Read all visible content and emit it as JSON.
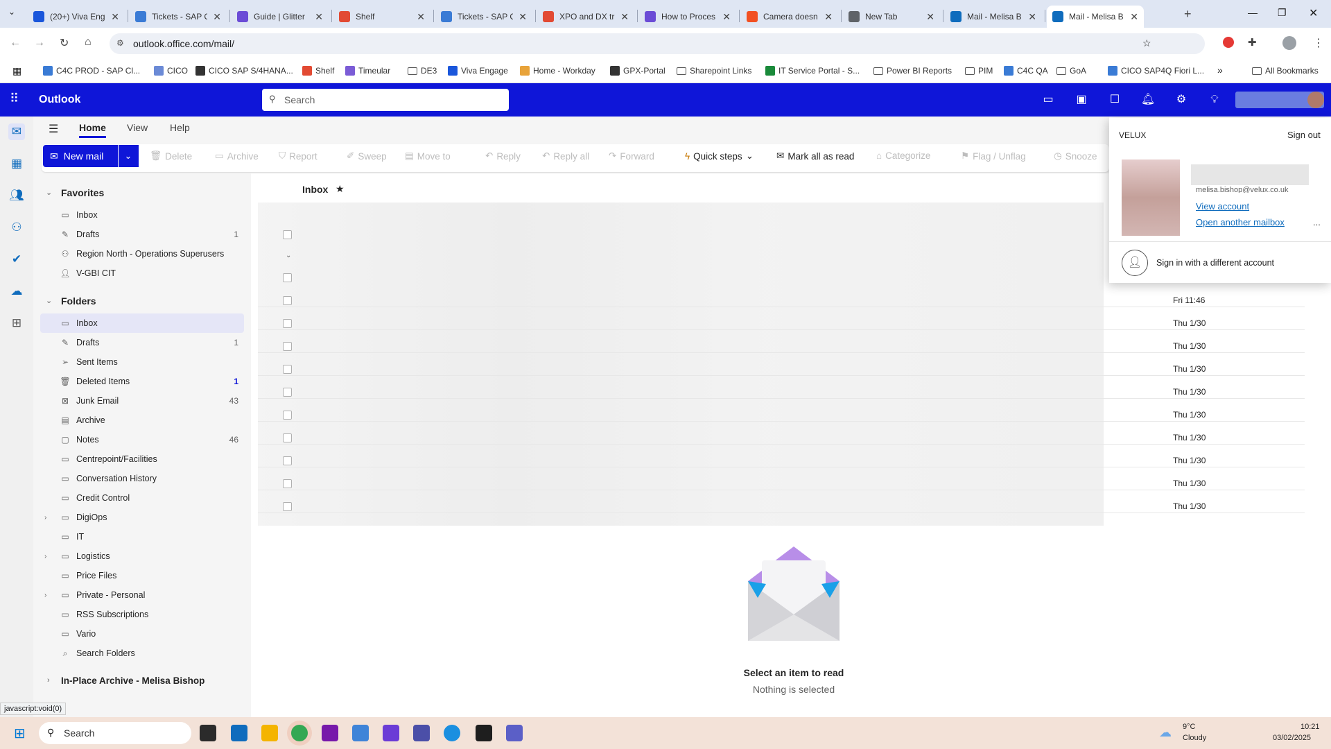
{
  "browser": {
    "tabs": [
      {
        "label": "(20+) Viva Eng",
        "color": "#1a56db"
      },
      {
        "label": "Tickets - SAP C",
        "color": "#3a7bd5"
      },
      {
        "label": "Guide | Glitter",
        "color": "#6b4cd6"
      },
      {
        "label": "Shelf",
        "color": "#e24a33"
      },
      {
        "label": "Tickets - SAP C",
        "color": "#3a7bd5"
      },
      {
        "label": "XPO and DX tr",
        "color": "#e24a33"
      },
      {
        "label": "How to Proces",
        "color": "#6b4cd6"
      },
      {
        "label": "Camera doesn",
        "color": "#f25022"
      },
      {
        "label": "New Tab",
        "color": "#5f6368"
      },
      {
        "label": "Mail - Melisa B",
        "color": "#0f6cbd"
      },
      {
        "label": "Mail - Melisa B",
        "color": "#0f6cbd"
      }
    ],
    "url": "outlook.office.com/mail/",
    "bookmarks": [
      "C4C PROD - SAP Cl...",
      "CICO",
      "CICO SAP S/4HANA...",
      "Shelf",
      "Timeular",
      "DE3",
      "Viva Engage",
      "Home - Workday",
      "GPX-Portal",
      "Sharepoint Links",
      "IT Service Portal - S...",
      "Power BI Reports",
      "PIM",
      "C4C QA",
      "GoA",
      "CICO SAP4Q Fiori L..."
    ],
    "all_bookmarks": "All Bookmarks",
    "status_url": "javascript:void(0)"
  },
  "outlook": {
    "app_name": "Outlook",
    "search_placeholder": "Search",
    "ribbon_tabs": [
      "Home",
      "View",
      "Help"
    ],
    "new_mail": "New mail",
    "actions": {
      "delete": "Delete",
      "archive": "Archive",
      "report": "Report",
      "sweep": "Sweep",
      "move_to": "Move to",
      "reply": "Reply",
      "reply_all": "Reply all",
      "forward": "Forward",
      "quick_steps": "Quick steps",
      "mark_all_read": "Mark all as read",
      "categorize": "Categorize",
      "flag": "Flag / Unflag",
      "snooze": "Snooze"
    },
    "favorites_label": "Favorites",
    "favorites": [
      {
        "label": "Inbox",
        "count": "",
        "icon": "inbox-icon"
      },
      {
        "label": "Drafts",
        "count": "1",
        "icon": "drafts-icon"
      },
      {
        "label": "Region North - Operations Superusers",
        "count": "",
        "icon": "group-icon"
      },
      {
        "label": "V-GBI CIT",
        "count": "",
        "icon": "person-icon"
      }
    ],
    "folders_label": "Folders",
    "folders": [
      {
        "label": "Inbox",
        "count": ""
      },
      {
        "label": "Drafts",
        "count": "1"
      },
      {
        "label": "Sent Items",
        "count": ""
      },
      {
        "label": "Deleted Items",
        "count": "1"
      },
      {
        "label": "Junk Email",
        "count": "43"
      },
      {
        "label": "Archive",
        "count": ""
      },
      {
        "label": "Notes",
        "count": "46"
      },
      {
        "label": "Centrepoint/Facilities",
        "count": ""
      },
      {
        "label": "Conversation History",
        "count": ""
      },
      {
        "label": "Credit Control",
        "count": ""
      },
      {
        "label": "DigiOps",
        "count": ""
      },
      {
        "label": "IT",
        "count": ""
      },
      {
        "label": "Logistics",
        "count": ""
      },
      {
        "label": "Price Files",
        "count": ""
      },
      {
        "label": "Private - Personal",
        "count": ""
      },
      {
        "label": "RSS Subscriptions",
        "count": ""
      },
      {
        "label": "Vario",
        "count": ""
      },
      {
        "label": "Search Folders",
        "count": ""
      }
    ],
    "archive_label": "In-Place Archive - Melisa Bishop",
    "list_title": "Inbox",
    "dates": [
      "Fri 11:46",
      "Thu 1/30",
      "Thu 1/30",
      "Thu 1/30",
      "Thu 1/30",
      "Thu 1/30",
      "Thu 1/30",
      "Thu 1/30",
      "Thu 1/30",
      "Thu 1/30"
    ],
    "reading_title": "Select an item to read",
    "reading_sub": "Nothing is selected",
    "account": {
      "org": "VELUX",
      "sign_out": "Sign out",
      "email": "melisa.bishop@velux.co.uk",
      "view_account": "View account",
      "open_mailbox": "Open another mailbox",
      "more": "...",
      "different": "Sign in with a different account"
    }
  },
  "taskbar": {
    "search": "Search",
    "temp": "9°C",
    "weather": "Cloudy",
    "time": "10:21",
    "date": "03/02/2025"
  }
}
